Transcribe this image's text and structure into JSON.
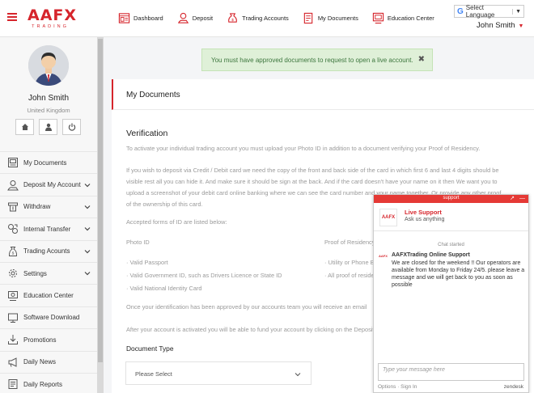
{
  "header": {
    "logo_brand": "AAFX",
    "logo_sub": "TRADING",
    "nav": [
      {
        "label": "Dashboard",
        "icon": "dashboard-icon"
      },
      {
        "label": "Deposit",
        "icon": "deposit-icon"
      },
      {
        "label": "Trading Accounts",
        "icon": "trading-accounts-icon"
      },
      {
        "label": "My Documents",
        "icon": "documents-icon"
      },
      {
        "label": "Education Center",
        "icon": "education-icon"
      }
    ],
    "language": {
      "g": "G",
      "label": "Select Language",
      "caret": "▼"
    },
    "username": "John Smith",
    "username_caret": "▼"
  },
  "profile": {
    "name": "John Smith",
    "country": "United Kingdom"
  },
  "sidebar": {
    "items": [
      {
        "label": "My Documents",
        "icon": "documents-icon"
      },
      {
        "label": "Deposit My Account",
        "icon": "deposit-icon",
        "has_chevron": true
      },
      {
        "label": "Withdraw",
        "icon": "withdraw-icon",
        "has_chevron": true
      },
      {
        "label": "Internal Transfer",
        "icon": "transfer-icon",
        "has_chevron": true
      },
      {
        "label": "Trading Acounts",
        "icon": "trading-accounts-icon",
        "has_chevron": true
      },
      {
        "label": "Settings",
        "icon": "gear-icon",
        "has_chevron": true
      },
      {
        "label": "Education Center",
        "icon": "education-icon"
      },
      {
        "label": "Software Download",
        "icon": "download-icon"
      },
      {
        "label": "Promotions",
        "icon": "promotions-icon"
      },
      {
        "label": "Daily News",
        "icon": "megaphone-icon"
      },
      {
        "label": "Daily Reports",
        "icon": "reports-icon"
      }
    ]
  },
  "alert": {
    "text": "You must have approved documents to request to open a live account.",
    "close": "✖"
  },
  "main": {
    "title": "My Documents",
    "verification_heading": "Verification",
    "intro": "To activate your individual trading account you must upload your Photo ID in addition to a document verifying your Proof of Residency.",
    "card_line1": "If you wish to deposit via Credit / Debit card we need the copy of the front and back side of the card in which first 6 and last 4 digits should be",
    "card_line2": "visible rest all you can hide it. And make sure it should be sign at the back. And if the card doesn't have your name on it then We want you to",
    "card_line3": "upload a screenshot of your debit card online banking where we can see the card number and your name together. Or provide any other proof",
    "card_line4": "of the ownership of this card.",
    "accepted_forms": "Accepted forms of ID are listed below:",
    "photo_id_heading": "Photo ID",
    "proof_heading": "Proof of Residency",
    "photo_id_items": [
      "Valid Passport",
      "Valid Government ID, such as Drivers Licence or State ID",
      "Valid National Identity Card"
    ],
    "proof_items": [
      "Utility or Phone Bill",
      "All proof of residence"
    ],
    "approved_note": "Once your identification has been approved by our accounts team you will receive an email",
    "fund_note": "After your account is activated you will be able to fund your account by clicking on the Deposit",
    "document_type_label": "Document Type",
    "document_type_value": "Please Select"
  },
  "support": {
    "header": "support",
    "ctrl_popout": "↗",
    "ctrl_minimize": "—",
    "logo": "AAFX",
    "agent_name": "Live Support",
    "agent_sub": "Ask us anything",
    "chat_started": "Chat started",
    "msg_logo": "AAFX",
    "msg_name": "AAFXTrading Online Support",
    "msg_body": "We are closed for the weekend !! Our operators are available from Monday to Friday 24/5. please leave a message and we will get back to you as soon as possible",
    "input_placeholder": "Type your message here",
    "footer_left": "Options · Sign In",
    "footer_right": "zendesk"
  },
  "colors": {
    "brand": "#d6252c",
    "alert_bg": "#dff0d8",
    "alert_text": "#3c763d",
    "support_header": "#e53935"
  }
}
